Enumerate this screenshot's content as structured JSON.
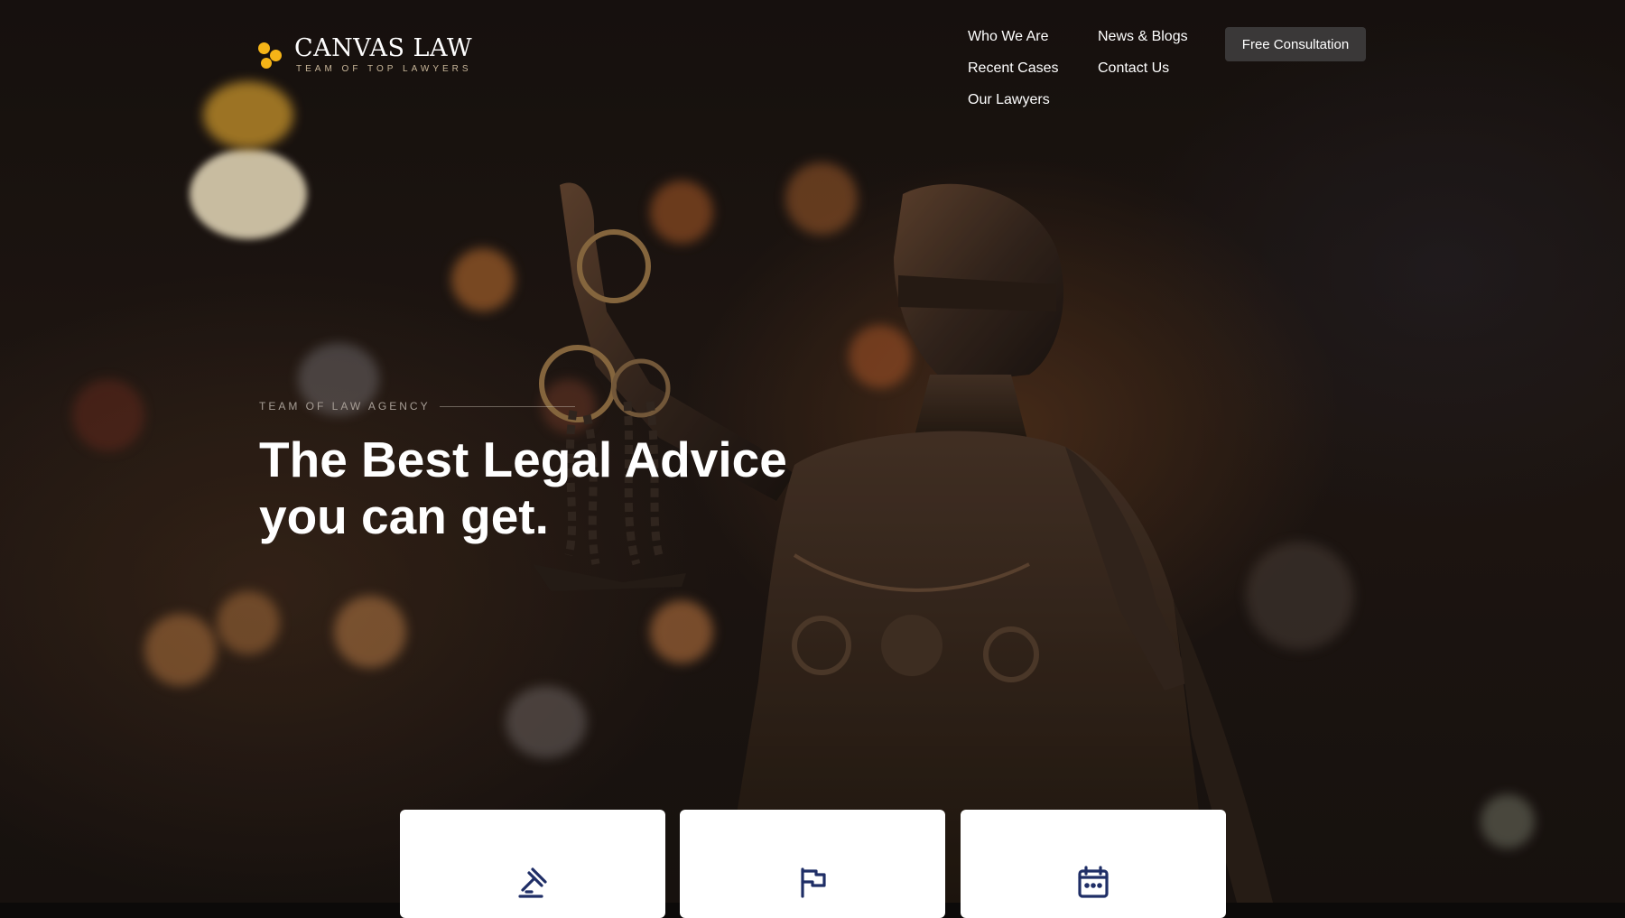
{
  "brand": {
    "name": "CANVAS LAW",
    "tagline": "TEAM OF TOP LAWYERS",
    "accent_color": "#f5b417"
  },
  "nav": {
    "items": [
      {
        "label": "Who We Are"
      },
      {
        "label": "News & Blogs"
      },
      {
        "label": "Recent Cases"
      },
      {
        "label": "Contact Us"
      },
      {
        "label": "Our Lawyers"
      }
    ],
    "cta_label": "Free Consultation"
  },
  "hero": {
    "eyebrow": "TEAM OF LAW AGENCY",
    "headline_line1": "The Best Legal Advice",
    "headline_line2": "you can get."
  },
  "feature_cards": [
    {
      "icon": "gavel-icon"
    },
    {
      "icon": "flag-icon"
    },
    {
      "icon": "calendar-icon"
    }
  ],
  "colors": {
    "icon_navy": "#1f2e66",
    "button_bg": "#3a3838"
  }
}
